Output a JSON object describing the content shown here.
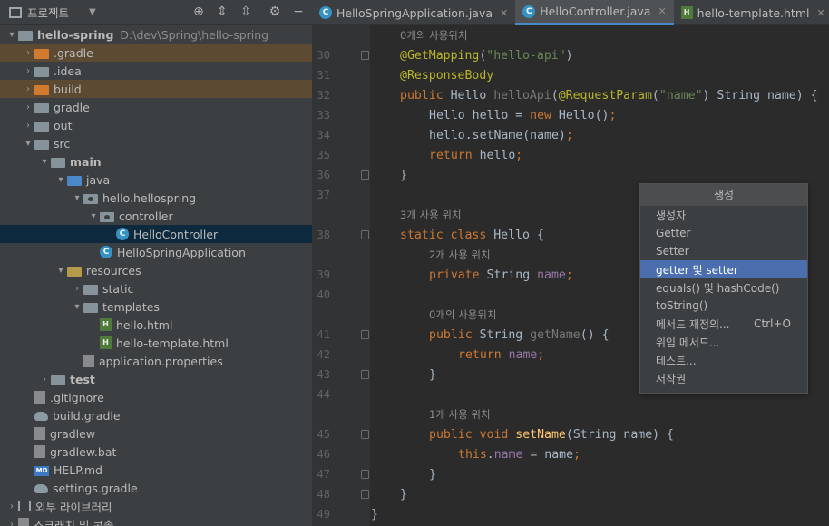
{
  "project": {
    "title": "프로젝트",
    "tree": [
      {
        "indent": 0,
        "arrow": "▾",
        "icon": "module",
        "label": "hello-spring",
        "path": "D:\\dev\\Spring\\hello-spring",
        "bold": true
      },
      {
        "indent": 1,
        "arrow": "›",
        "icon": "folder-orange",
        "label": ".gradle",
        "excluded": true
      },
      {
        "indent": 1,
        "arrow": "›",
        "icon": "folder",
        "label": ".idea"
      },
      {
        "indent": 1,
        "arrow": "›",
        "icon": "folder-orange",
        "label": "build",
        "excluded": true
      },
      {
        "indent": 1,
        "arrow": "›",
        "icon": "folder",
        "label": "gradle"
      },
      {
        "indent": 1,
        "arrow": "›",
        "icon": "folder",
        "label": "out"
      },
      {
        "indent": 1,
        "arrow": "▾",
        "icon": "folder",
        "label": "src"
      },
      {
        "indent": 2,
        "arrow": "▾",
        "icon": "folder",
        "label": "main",
        "bold": true
      },
      {
        "indent": 3,
        "arrow": "▾",
        "icon": "folder-blue",
        "label": "java"
      },
      {
        "indent": 4,
        "arrow": "▾",
        "icon": "package",
        "label": "hello.hellospring"
      },
      {
        "indent": 5,
        "arrow": "▾",
        "icon": "package",
        "label": "controller"
      },
      {
        "indent": 6,
        "arrow": "",
        "icon": "class",
        "label": "HelloController",
        "selected": true
      },
      {
        "indent": 5,
        "arrow": "",
        "icon": "class",
        "label": "HelloSpringApplication"
      },
      {
        "indent": 3,
        "arrow": "▾",
        "icon": "folder-res",
        "label": "resources"
      },
      {
        "indent": 4,
        "arrow": "›",
        "icon": "folder",
        "label": "static"
      },
      {
        "indent": 4,
        "arrow": "▾",
        "icon": "folder",
        "label": "templates"
      },
      {
        "indent": 5,
        "arrow": "",
        "icon": "html",
        "label": "hello.html"
      },
      {
        "indent": 5,
        "arrow": "",
        "icon": "html",
        "label": "hello-template.html"
      },
      {
        "indent": 4,
        "arrow": "",
        "icon": "file",
        "label": "application.properties"
      },
      {
        "indent": 2,
        "arrow": "›",
        "icon": "folder",
        "label": "test",
        "bold": true
      },
      {
        "indent": 1,
        "arrow": "",
        "icon": "file",
        "label": ".gitignore"
      },
      {
        "indent": 1,
        "arrow": "",
        "icon": "gradle",
        "label": "build.gradle"
      },
      {
        "indent": 1,
        "arrow": "",
        "icon": "file",
        "label": "gradlew"
      },
      {
        "indent": 1,
        "arrow": "",
        "icon": "file",
        "label": "gradlew.bat"
      },
      {
        "indent": 1,
        "arrow": "",
        "icon": "md",
        "label": "HELP.md"
      },
      {
        "indent": 1,
        "arrow": "",
        "icon": "gradle",
        "label": "settings.gradle"
      },
      {
        "indent": 0,
        "arrow": "›",
        "icon": "library",
        "label": "외부 라이브러리"
      },
      {
        "indent": 0,
        "arrow": "›",
        "icon": "file",
        "label": "스크래치 및 콘솔"
      }
    ]
  },
  "tabs": [
    {
      "label": "HelloSpringApplication.java",
      "icon": "class",
      "active": false
    },
    {
      "label": "HelloController.java",
      "icon": "class",
      "active": true
    },
    {
      "label": "hello-template.html",
      "icon": "html",
      "active": false
    }
  ],
  "editor": {
    "lines": [
      {
        "ln": "",
        "hint": "0개의 사용위치",
        "indent": 1
      },
      {
        "ln": "30",
        "fold": true,
        "html": "<span class='ann'>@GetMapping</span>(<span class='str'>\"hello-api\"</span>)",
        "indent": 1
      },
      {
        "ln": "31",
        "html": "<span class='ann'>@ResponseBody</span>",
        "indent": 1
      },
      {
        "ln": "32",
        "html": "<span class='kw'>public</span> Hello <span class='gray'>helloApi</span>(<span class='ann'>@RequestParam</span>(<span class='str'>\"name\"</span>) String name) {",
        "indent": 1
      },
      {
        "ln": "33",
        "html": "Hello hello = <span class='kw'>new</span> Hello()<span class='kw'>;</span>",
        "indent": 2
      },
      {
        "ln": "34",
        "html": "hello.setName(name)<span class='kw'>;</span>",
        "indent": 2
      },
      {
        "ln": "35",
        "html": "<span class='kw'>return</span> hello<span class='kw'>;</span>",
        "indent": 2
      },
      {
        "ln": "36",
        "fold": true,
        "html": "}",
        "indent": 1
      },
      {
        "ln": "37",
        "html": "",
        "indent": 0
      },
      {
        "ln": "",
        "hint": "3개 사용 위치",
        "indent": 1
      },
      {
        "ln": "38",
        "fold": true,
        "html": "<span class='kw'>static class</span> Hello {",
        "indent": 1
      },
      {
        "ln": "",
        "hint": "2개 사용 위치",
        "indent": 2
      },
      {
        "ln": "39",
        "html": "<span class='kw'>private</span> String <span class='fld'>name</span><span class='kw'>;</span>",
        "indent": 2
      },
      {
        "ln": "40",
        "html": "",
        "indent": 0
      },
      {
        "ln": "",
        "hint": "0개의 사용위치",
        "indent": 2
      },
      {
        "ln": "41",
        "fold": true,
        "html": "<span class='kw'>public</span> String <span class='gray'>getName</span>() {",
        "indent": 2
      },
      {
        "ln": "42",
        "html": "<span class='kw'>return</span> <span class='fld'>name</span><span class='kw'>;</span>",
        "indent": 3
      },
      {
        "ln": "43",
        "fold": true,
        "html": "}",
        "indent": 2
      },
      {
        "ln": "44",
        "html": "",
        "indent": 0
      },
      {
        "ln": "",
        "hint": "1개 사용 위치",
        "indent": 2
      },
      {
        "ln": "45",
        "fold": true,
        "html": "<span class='kw'>public void</span> <span class='fn'>setName</span>(String name) {",
        "indent": 2
      },
      {
        "ln": "46",
        "html": "<span class='kw'>this</span>.<span class='fld'>name</span> = name<span class='kw'>;</span>",
        "indent": 3
      },
      {
        "ln": "47",
        "fold": true,
        "html": "}",
        "indent": 2
      },
      {
        "ln": "48",
        "fold": true,
        "html": "}",
        "indent": 1
      },
      {
        "ln": "49",
        "html": "}",
        "indent": 0
      }
    ]
  },
  "popup": {
    "title": "생성",
    "items": [
      {
        "label": "생성자"
      },
      {
        "label": "Getter"
      },
      {
        "label": "Setter"
      },
      {
        "label": "getter 및 setter",
        "selected": true
      },
      {
        "label": "equals() 및 hashCode()"
      },
      {
        "label": "toString()"
      },
      {
        "label": "메서드 재정의...",
        "shortcut": "Ctrl+O"
      },
      {
        "label": "위임 메서드..."
      },
      {
        "label": "테스트..."
      },
      {
        "label": "저작권"
      }
    ]
  }
}
